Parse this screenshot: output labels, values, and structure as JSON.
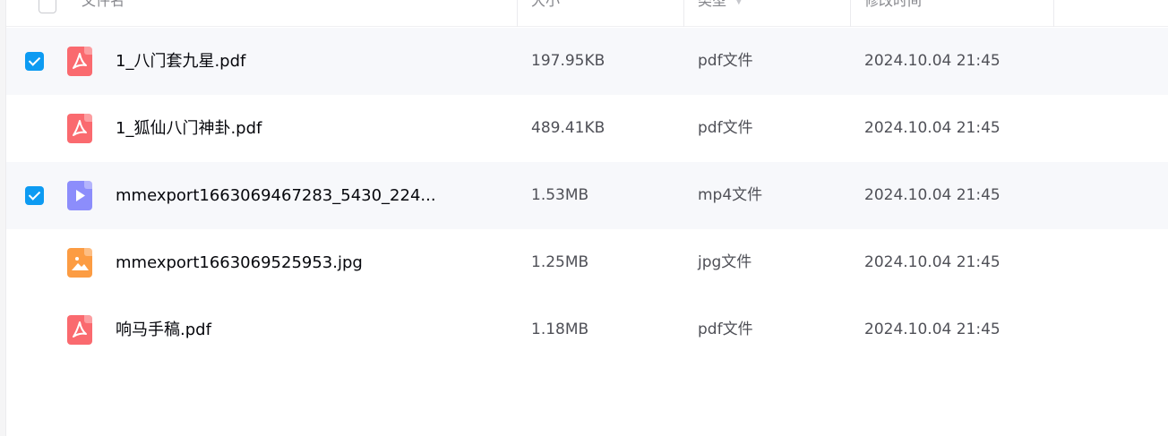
{
  "header": {
    "name_label": "文件名",
    "size_label": "大小",
    "type_label": "类型",
    "modified_label": "修改时间"
  },
  "files": [
    {
      "name": "1_八门套九星.pdf",
      "size": "197.95KB",
      "type": "pdf文件",
      "modified": "2024.10.04 21:45",
      "icon": "pdf-file-icon",
      "selected": true
    },
    {
      "name": "1_狐仙八门神卦.pdf",
      "size": "489.41KB",
      "type": "pdf文件",
      "modified": "2024.10.04 21:45",
      "icon": "pdf-file-icon",
      "selected": false
    },
    {
      "name": "mmexport1663069467283_5430_224...",
      "size": "1.53MB",
      "type": "mp4文件",
      "modified": "2024.10.04 21:45",
      "icon": "video-file-icon",
      "selected": true
    },
    {
      "name": "mmexport1663069525953.jpg",
      "size": "1.25MB",
      "type": "jpg文件",
      "modified": "2024.10.04 21:45",
      "icon": "image-file-icon",
      "selected": false
    },
    {
      "name": "响马手稿.pdf",
      "size": "1.18MB",
      "type": "pdf文件",
      "modified": "2024.10.04 21:45",
      "icon": "pdf-file-icon",
      "selected": false
    }
  ],
  "colors": {
    "checkbox_checked": "#0d9bf2",
    "selected_row_bg": "#f7f8fb",
    "pdf_icon": "#fa6a6f",
    "video_icon": "#8c8dfb",
    "image_icon": "#fc9c43"
  }
}
